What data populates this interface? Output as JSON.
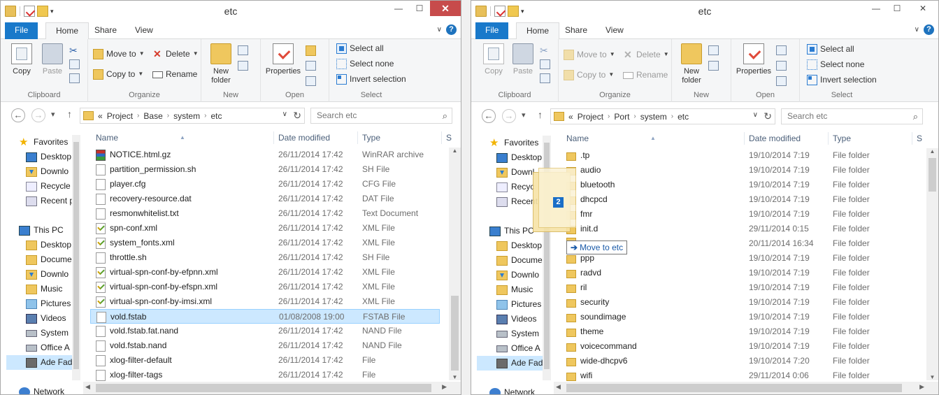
{
  "left": {
    "title": "etc",
    "tabs": [
      "File",
      "Home",
      "Share",
      "View"
    ],
    "ribbon": {
      "clipboard": {
        "copy": "Copy",
        "paste": "Paste",
        "label": "Clipboard"
      },
      "organize": {
        "move_to": "Move to",
        "copy_to": "Copy to",
        "delete": "Delete",
        "rename": "Rename",
        "label": "Organize"
      },
      "new": {
        "new_folder_1": "New",
        "new_folder_2": "folder",
        "label": "New"
      },
      "open": {
        "properties": "Properties",
        "label": "Open"
      },
      "select": {
        "select_all": "Select all",
        "select_none": "Select none",
        "invert": "Invert selection",
        "label": "Select"
      }
    },
    "address": {
      "prefix": "«",
      "crumbs": [
        "Project",
        "Base",
        "system",
        "etc"
      ]
    },
    "search_placeholder": "Search etc",
    "columns": {
      "name": "Name",
      "date": "Date modified",
      "type": "Type",
      "size": "S"
    },
    "nav": [
      "Favorites",
      "Desktop",
      "Downlo",
      "Recycle",
      "Recent p",
      "This PC",
      "Desktop",
      "Docume",
      "Downlo",
      "Music",
      "Pictures",
      "Videos",
      "System",
      "Office A",
      "Ade Fad",
      "Network"
    ],
    "files": [
      {
        "name": "NOTICE.html.gz",
        "date": "26/11/2014 17:42",
        "type": "WinRAR archive",
        "icon": "rar-icon"
      },
      {
        "name": "partition_permission.sh",
        "date": "26/11/2014 17:42",
        "type": "SH File",
        "icon": "file-icon"
      },
      {
        "name": "player.cfg",
        "date": "26/11/2014 17:42",
        "type": "CFG File",
        "icon": "file-icon"
      },
      {
        "name": "recovery-resource.dat",
        "date": "26/11/2014 17:42",
        "type": "DAT File",
        "icon": "file-icon"
      },
      {
        "name": "resmonwhitelist.txt",
        "date": "26/11/2014 17:42",
        "type": "Text Document",
        "icon": "file-icon"
      },
      {
        "name": "spn-conf.xml",
        "date": "26/11/2014 17:42",
        "type": "XML File",
        "icon": "xml-icon"
      },
      {
        "name": "system_fonts.xml",
        "date": "26/11/2014 17:42",
        "type": "XML File",
        "icon": "xml-icon"
      },
      {
        "name": "throttle.sh",
        "date": "26/11/2014 17:42",
        "type": "SH File",
        "icon": "file-icon"
      },
      {
        "name": "virtual-spn-conf-by-efpnn.xml",
        "date": "26/11/2014 17:42",
        "type": "XML File",
        "icon": "xml-icon"
      },
      {
        "name": "virtual-spn-conf-by-efspn.xml",
        "date": "26/11/2014 17:42",
        "type": "XML File",
        "icon": "xml-icon"
      },
      {
        "name": "virtual-spn-conf-by-imsi.xml",
        "date": "26/11/2014 17:42",
        "type": "XML File",
        "icon": "xml-icon"
      },
      {
        "name": "vold.fstab",
        "date": "01/08/2008 19:00",
        "type": "FSTAB File",
        "icon": "file-icon"
      },
      {
        "name": "vold.fstab.fat.nand",
        "date": "26/11/2014 17:42",
        "type": "NAND File",
        "icon": "file-icon"
      },
      {
        "name": "vold.fstab.nand",
        "date": "26/11/2014 17:42",
        "type": "NAND File",
        "icon": "file-icon"
      },
      {
        "name": "xlog-filter-default",
        "date": "26/11/2014 17:42",
        "type": "File",
        "icon": "file-icon"
      },
      {
        "name": "xlog-filter-tags",
        "date": "26/11/2014 17:42",
        "type": "File",
        "icon": "file-icon"
      }
    ]
  },
  "right": {
    "title": "etc",
    "tabs": [
      "File",
      "Home",
      "Share",
      "View"
    ],
    "ribbon": {
      "clipboard": {
        "copy": "Copy",
        "paste": "Paste",
        "label": "Clipboard"
      },
      "organize": {
        "move_to": "Move to",
        "copy_to": "Copy to",
        "delete": "Delete",
        "rename": "Rename",
        "label": "Organize"
      },
      "new": {
        "new_folder_1": "New",
        "new_folder_2": "folder",
        "label": "New"
      },
      "open": {
        "properties": "Properties",
        "label": "Open"
      },
      "select": {
        "select_all": "Select all",
        "select_none": "Select none",
        "invert": "Invert selection",
        "label": "Select"
      }
    },
    "address": {
      "prefix": "«",
      "crumbs": [
        "Project",
        "Port",
        "system",
        "etc"
      ]
    },
    "search_placeholder": "Search etc",
    "columns": {
      "name": "Name",
      "date": "Date modified",
      "type": "Type",
      "size": "S"
    },
    "nav": [
      "Favorites",
      "Desktop",
      "Downl",
      "Recyc",
      "Recent",
      "This PC",
      "Desktop",
      "Docume",
      "Downlo",
      "Music",
      "Pictures",
      "Videos",
      "System",
      "Office A",
      "Ade Fad",
      "Network"
    ],
    "files": [
      {
        "name": ".tp",
        "date": "19/10/2014 7:19",
        "type": "File folder"
      },
      {
        "name": "audio",
        "date": "19/10/2014 7:19",
        "type": "File folder"
      },
      {
        "name": "bluetooth",
        "date": "19/10/2014 7:19",
        "type": "File folder"
      },
      {
        "name": "dhcpcd",
        "date": "19/10/2014 7:19",
        "type": "File folder"
      },
      {
        "name": "fmr",
        "date": "19/10/2014 7:19",
        "type": "File folder"
      },
      {
        "name": "init.d",
        "date": "29/11/2014 0:15",
        "type": "File folder"
      },
      {
        "name": "",
        "date": "20/11/2014 16:34",
        "type": "File folder"
      },
      {
        "name": "ppp",
        "date": "19/10/2014 7:19",
        "type": "File folder"
      },
      {
        "name": "radvd",
        "date": "19/10/2014 7:19",
        "type": "File folder"
      },
      {
        "name": "ril",
        "date": "19/10/2014 7:19",
        "type": "File folder"
      },
      {
        "name": "security",
        "date": "19/10/2014 7:19",
        "type": "File folder"
      },
      {
        "name": "soundimage",
        "date": "19/10/2014 7:19",
        "type": "File folder"
      },
      {
        "name": "theme",
        "date": "19/10/2014 7:19",
        "type": "File folder"
      },
      {
        "name": "voicecommand",
        "date": "19/10/2014 7:19",
        "type": "File folder"
      },
      {
        "name": "wide-dhcpv6",
        "date": "19/10/2014 7:20",
        "type": "File folder"
      },
      {
        "name": "wifi",
        "date": "29/11/2014 0:06",
        "type": "File folder"
      }
    ]
  },
  "drag": {
    "count": "2",
    "tooltip": "Move to etc"
  }
}
